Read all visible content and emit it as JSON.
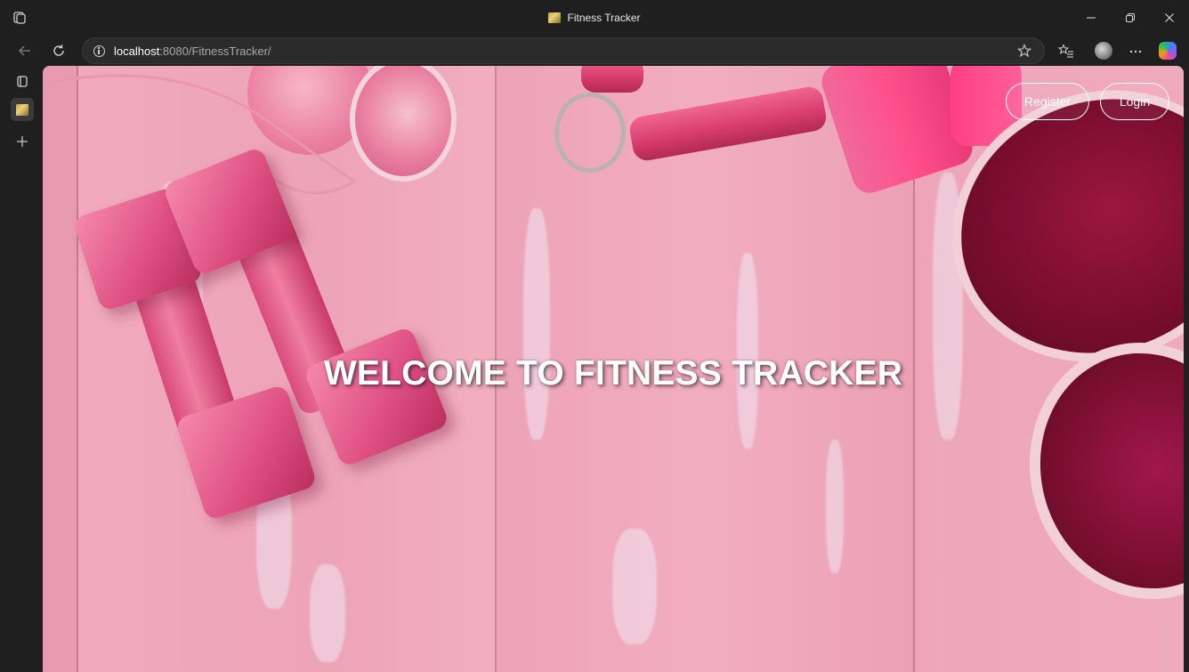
{
  "window": {
    "title": "Fitness Tracker",
    "controls": [
      "minimize",
      "restore",
      "close"
    ]
  },
  "addressbar": {
    "url_host": "localhost",
    "url_rest": ":8080/FitnessTracker/"
  },
  "sidebar": {
    "icons": [
      "tab-actions-icon",
      "active-tab-favicon",
      "new-tab-icon"
    ]
  },
  "page": {
    "heading": "WELCOME TO FITNESS TRACKER",
    "register_label": "Register",
    "login_label": "Login"
  },
  "colors": {
    "background_pink": "#eea6bb",
    "dumbbell_pink": "#e05284",
    "shoe_red": "#8e1238",
    "text_white": "#ffffff"
  }
}
